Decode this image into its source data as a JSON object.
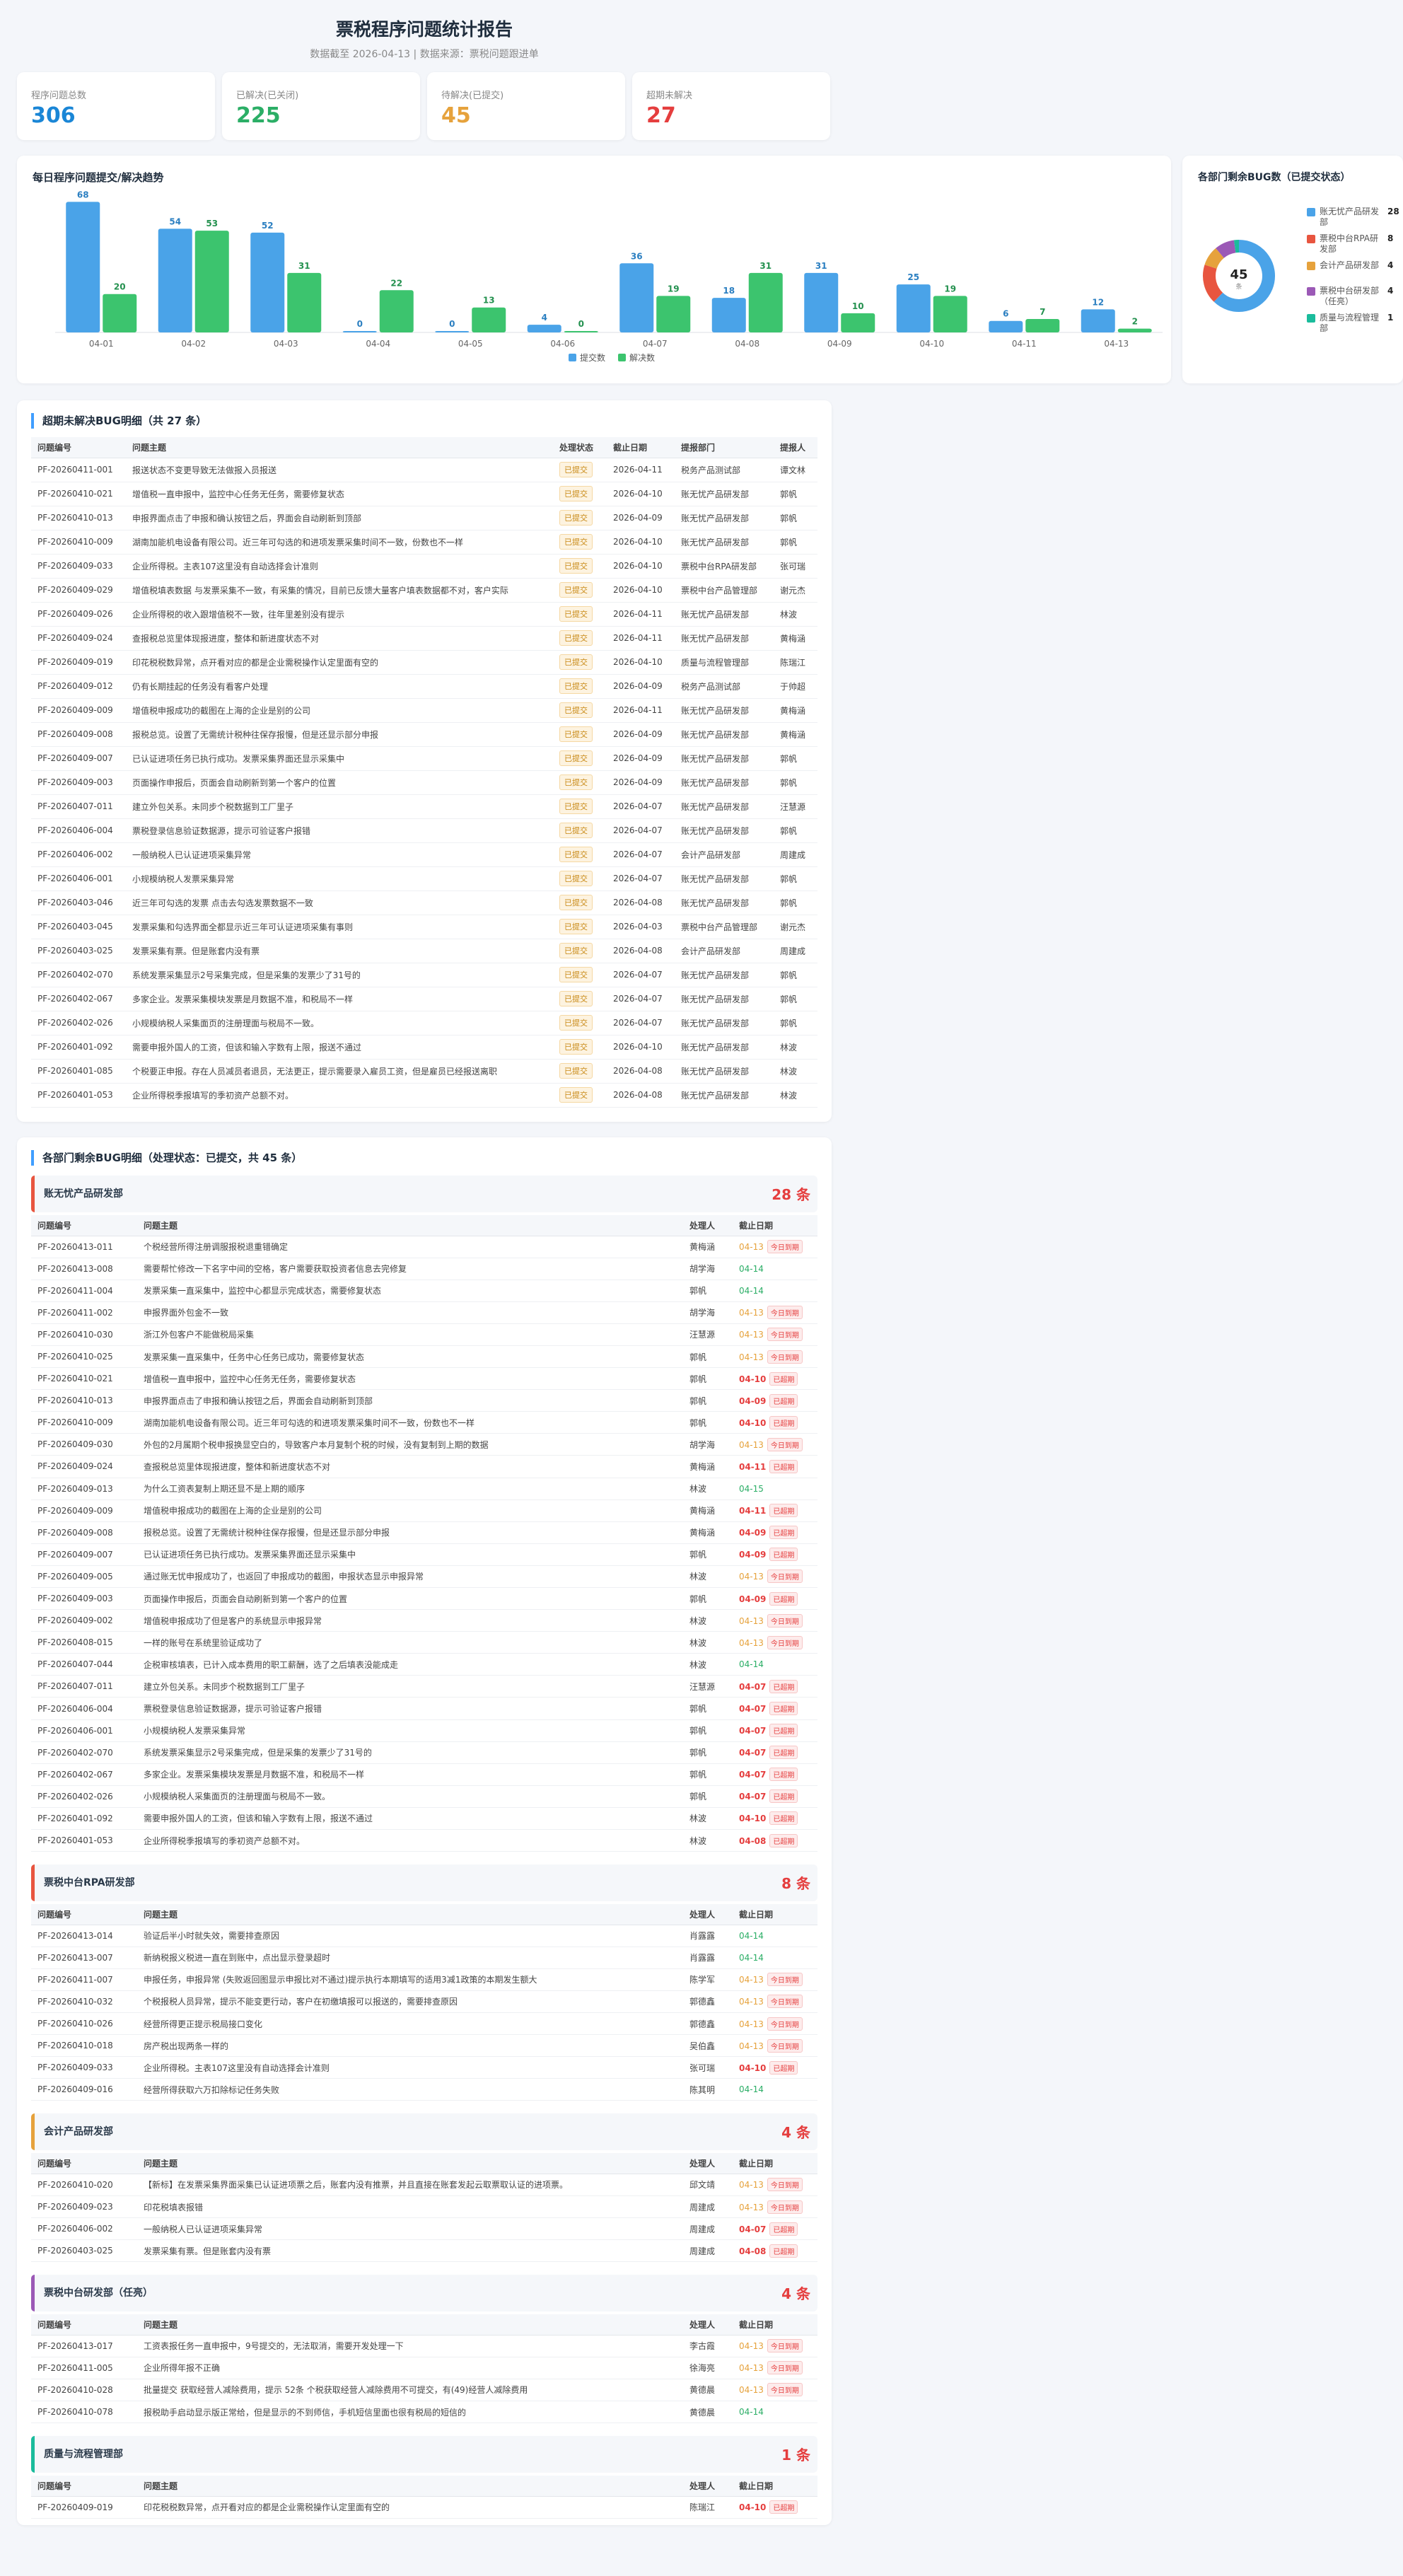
{
  "header": {
    "title": "票税程序问题统计报告",
    "subtitle": "数据截至 2026-04-13 | 数据来源：票税问题跟进单"
  },
  "stats": [
    {
      "label": "程序问题总数",
      "value": "306",
      "color": "#1a86d6"
    },
    {
      "label": "已解决(已关闭)",
      "value": "225",
      "color": "#2bae66"
    },
    {
      "label": "待解决(已提交)",
      "value": "45",
      "color": "#e6a23c"
    },
    {
      "label": "超期未解决",
      "value": "27",
      "color": "#e53e3e"
    }
  ],
  "trend": {
    "title": "每日程序问题提交/解决趋势",
    "legend": [
      "提交数",
      "解决数"
    ],
    "colors": {
      "submit": "#4aa3e8",
      "resolve": "#3cc46e"
    }
  },
  "chart_data": [
    {
      "type": "bar",
      "title": "每日程序问题提交/解决趋势",
      "categories": [
        "04-01",
        "04-02",
        "04-03",
        "04-04",
        "04-05",
        "04-06",
        "04-07",
        "04-08",
        "04-09",
        "04-10",
        "04-11",
        "04-13"
      ],
      "series": [
        {
          "name": "提交数",
          "values": [
            68,
            54,
            52,
            0,
            0,
            4,
            36,
            18,
            31,
            25,
            6,
            12
          ]
        },
        {
          "name": "解决数",
          "values": [
            20,
            53,
            31,
            22,
            13,
            0,
            19,
            31,
            10,
            19,
            7,
            2
          ]
        }
      ],
      "ylim": [
        0,
        70
      ],
      "legend": "bottom"
    },
    {
      "type": "pie",
      "title": "各部门剩余BUG数（已提交状态）",
      "center_total": "45",
      "center_label": "条",
      "labels": [
        "账无忧产品研发部",
        "票税中台RPA研发部",
        "会计产品研发部",
        "票税中台研发部（任亮）",
        "质量与流程管理部"
      ],
      "values": [
        28,
        8,
        4,
        4,
        1
      ],
      "colors": [
        "#4aa3e8",
        "#e8553f",
        "#e6a23c",
        "#9b59b6",
        "#1abc9c"
      ]
    }
  ],
  "donut": {
    "title": "各部门剩余BUG数（已提交状态）"
  },
  "overdue": {
    "title": "超期未解决BUG明细（共 27 条）",
    "columns": [
      "问题编号",
      "问题主题",
      "处理状态",
      "截止日期",
      "提报部门",
      "提报人"
    ],
    "rows": [
      [
        "PF-20260411-001",
        "报送状态不变更导致无法做报入员报送",
        "已提交",
        "2026-04-11",
        "税务产品测试部",
        "谭文林"
      ],
      [
        "PF-20260410-021",
        "增值税一直申报中，监控中心任务无任务，需要修复状态",
        "已提交",
        "2026-04-10",
        "账无忧产品研发部",
        "郭帆"
      ],
      [
        "PF-20260410-013",
        "申报界面点击了申报和确认按钮之后，界面会自动刷新到顶部",
        "已提交",
        "2026-04-09",
        "账无忧产品研发部",
        "郭帆"
      ],
      [
        "PF-20260410-009",
        "湖南加能机电设备有限公司。近三年可勾选的和进项发票采集时间不一致，份数也不一样",
        "已提交",
        "2026-04-10",
        "账无忧产品研发部",
        "郭帆"
      ],
      [
        "PF-20260409-033",
        "企业所得税。主表107这里没有自动选择会计准则",
        "已提交",
        "2026-04-10",
        "票税中台RPA研发部",
        "张可瑞"
      ],
      [
        "PF-20260409-029",
        "增值税填表数据 与发票采集不一致，有采集的情况，目前已反馈大量客户填表数据都不对，客户实际",
        "已提交",
        "2026-04-10",
        "票税中台产品管理部",
        "谢元杰"
      ],
      [
        "PF-20260409-026",
        "企业所得税的收入跟增值税不一致，往年里差别没有提示",
        "已提交",
        "2026-04-11",
        "账无忧产品研发部",
        "林波"
      ],
      [
        "PF-20260409-024",
        "查报税总览里体现报进度，整体和新进度状态不对",
        "已提交",
        "2026-04-11",
        "账无忧产品研发部",
        "黄梅涵"
      ],
      [
        "PF-20260409-019",
        "印花税税数异常，点开看对应的都是企业需税操作认定里面有空的",
        "已提交",
        "2026-04-10",
        "质量与流程管理部",
        "陈瑞江"
      ],
      [
        "PF-20260409-012",
        "仍有长期挂起的任务没有看客户处理",
        "已提交",
        "2026-04-09",
        "税务产品测试部",
        "于帅超"
      ],
      [
        "PF-20260409-009",
        "增值税申报成功的截图在上海的企业是别的公司",
        "已提交",
        "2026-04-11",
        "账无忧产品研发部",
        "黄梅涵"
      ],
      [
        "PF-20260409-008",
        "报税总览。设置了无需统计税种往保存报慢，但是还显示部分申报",
        "已提交",
        "2026-04-09",
        "账无忧产品研发部",
        "黄梅涵"
      ],
      [
        "PF-20260409-007",
        "已认证进项任务已执行成功。发票采集界面还显示采集中",
        "已提交",
        "2026-04-09",
        "账无忧产品研发部",
        "郭帆"
      ],
      [
        "PF-20260409-003",
        "页面操作申报后，页面会自动刷新到第一个客户的位置",
        "已提交",
        "2026-04-09",
        "账无忧产品研发部",
        "郭帆"
      ],
      [
        "PF-20260407-011",
        "建立外包关系。未同步个税数据到工厂里子",
        "已提交",
        "2026-04-07",
        "账无忧产品研发部",
        "汪慧源"
      ],
      [
        "PF-20260406-004",
        "票税登录信息验证数据源，提示可验证客户报错",
        "已提交",
        "2026-04-07",
        "账无忧产品研发部",
        "郭帆"
      ],
      [
        "PF-20260406-002",
        "一般纳税人已认证进项采集异常",
        "已提交",
        "2026-04-07",
        "会计产品研发部",
        "周建成"
      ],
      [
        "PF-20260406-001",
        "小规模纳税人发票采集异常",
        "已提交",
        "2026-04-07",
        "账无忧产品研发部",
        "郭帆"
      ],
      [
        "PF-20260403-046",
        "近三年可勾选的发票 点击去勾选发票数据不一致",
        "已提交",
        "2026-04-08",
        "账无忧产品研发部",
        "郭帆"
      ],
      [
        "PF-20260403-045",
        "发票采集和勾选界面全都显示近三年可认证进项采集有事则",
        "已提交",
        "2026-04-03",
        "票税中台产品管理部",
        "谢元杰"
      ],
      [
        "PF-20260403-025",
        "发票采集有票。但是账套内没有票",
        "已提交",
        "2026-04-08",
        "会计产品研发部",
        "周建成"
      ],
      [
        "PF-20260402-070",
        "系统发票采集显示2号采集完成，但是采集的发票少了31号的",
        "已提交",
        "2026-04-07",
        "账无忧产品研发部",
        "郭帆"
      ],
      [
        "PF-20260402-067",
        "多家企业。发票采集模块发票是月数据不准，和税局不一样",
        "已提交",
        "2026-04-07",
        "账无忧产品研发部",
        "郭帆"
      ],
      [
        "PF-20260402-026",
        "小规模纳税人采集面页的注册理面与税局不一致。",
        "已提交",
        "2026-04-07",
        "账无忧产品研发部",
        "郭帆"
      ],
      [
        "PF-20260401-092",
        "需要申报外国人的工资，但该和输入字数有上限，报送不通过",
        "已提交",
        "2026-04-10",
        "账无忧产品研发部",
        "林波"
      ],
      [
        "PF-20260401-085",
        "个税要正申报。存在人员减员者退员，无法更正，提示需要录入雇员工资，但是雇员已经报送离职",
        "已提交",
        "2026-04-08",
        "账无忧产品研发部",
        "林波"
      ],
      [
        "PF-20260401-053",
        "企业所得税季报填写的季初资产总额不对。",
        "已提交",
        "2026-04-08",
        "账无忧产品研发部",
        "林波"
      ]
    ]
  },
  "dept_detail": {
    "title": "各部门剩余BUG明细（处理状态：已提交，共 45 条）",
    "columns": [
      "问题编号",
      "问题主题",
      "处理人",
      "截止日期"
    ],
    "tags": {
      "today": "今日到期",
      "over": "已超期"
    },
    "groups": [
      {
        "name": "账无忧产品研发部",
        "count": "28 条",
        "color": "#e8553f",
        "rows": [
          [
            "PF-20260413-011",
            "个税经营所得注册调服报税退重错确定",
            "黄梅涵",
            "04-13",
            "today"
          ],
          [
            "PF-20260413-008",
            "需要帮忙修改一下名字中间的空格，客户需要获取投资者信息去完修复",
            "胡学海",
            "04-14",
            "ok"
          ],
          [
            "PF-20260411-004",
            "发票采集一直采集中，监控中心都显示完成状态，需要修复状态",
            "郭帆",
            "04-14",
            "ok"
          ],
          [
            "PF-20260411-002",
            "申报界面外包金不一致",
            "胡学海",
            "04-13",
            "today"
          ],
          [
            "PF-20260410-030",
            "浙江外包客户不能做税局采集",
            "汪慧源",
            "04-13",
            "today"
          ],
          [
            "PF-20260410-025",
            "发票采集一直采集中，任务中心任务已成功，需要修复状态",
            "郭帆",
            "04-13",
            "today"
          ],
          [
            "PF-20260410-021",
            "增值税一直申报中，监控中心任务无任务，需要修复状态",
            "郭帆",
            "04-10",
            "over"
          ],
          [
            "PF-20260410-013",
            "申报界面点击了申报和确认按钮之后，界面会自动刷新到顶部",
            "郭帆",
            "04-09",
            "over"
          ],
          [
            "PF-20260410-009",
            "湖南加能机电设备有限公司。近三年可勾选的和进项发票采集时间不一致，份数也不一样",
            "郭帆",
            "04-10",
            "over"
          ],
          [
            "PF-20260409-030",
            "外包的2月属期个税申报换显空白的，导致客户本月复制个税的时候，没有复制到上期的数据",
            "胡学海",
            "04-13",
            "today"
          ],
          [
            "PF-20260409-024",
            "查报税总览里体现报进度，整体和新进度状态不对",
            "黄梅涵",
            "04-11",
            "over"
          ],
          [
            "PF-20260409-013",
            "为什么工资表复制上期还显不是上期的顺序",
            "林波",
            "04-15",
            "ok"
          ],
          [
            "PF-20260409-009",
            "增值税申报成功的截图在上海的企业是别的公司",
            "黄梅涵",
            "04-11",
            "over"
          ],
          [
            "PF-20260409-008",
            "报税总览。设置了无需统计税种往保存报慢，但是还显示部分申报",
            "黄梅涵",
            "04-09",
            "over"
          ],
          [
            "PF-20260409-007",
            "已认证进项任务已执行成功。发票采集界面还显示采集中",
            "郭帆",
            "04-09",
            "over"
          ],
          [
            "PF-20260409-005",
            "通过账无忧申报成功了，也返回了申报成功的截图，申报状态显示申报异常",
            "林波",
            "04-13",
            "today"
          ],
          [
            "PF-20260409-003",
            "页面操作申报后，页面会自动刷新到第一个客户的位置",
            "郭帆",
            "04-09",
            "over"
          ],
          [
            "PF-20260409-002",
            "增值税申报成功了但是客户的系统显示申报异常",
            "林波",
            "04-13",
            "today"
          ],
          [
            "PF-20260408-015",
            "一样的账号在系统里验证成功了",
            "林波",
            "04-13",
            "today"
          ],
          [
            "PF-20260407-044",
            "企税审核填表，已计入成本费用的职工薪酬，选了之后填表没能成走",
            "林波",
            "04-14",
            "ok"
          ],
          [
            "PF-20260407-011",
            "建立外包关系。未同步个税数据到工厂里子",
            "汪慧源",
            "04-07",
            "over"
          ],
          [
            "PF-20260406-004",
            "票税登录信息验证数据源，提示可验证客户报错",
            "郭帆",
            "04-07",
            "over"
          ],
          [
            "PF-20260406-001",
            "小规模纳税人发票采集异常",
            "郭帆",
            "04-07",
            "over"
          ],
          [
            "PF-20260402-070",
            "系统发票采集显示2号采集完成，但是采集的发票少了31号的",
            "郭帆",
            "04-07",
            "over"
          ],
          [
            "PF-20260402-067",
            "多家企业。发票采集模块发票是月数据不准，和税局不一样",
            "郭帆",
            "04-07",
            "over"
          ],
          [
            "PF-20260402-026",
            "小规模纳税人采集面页的注册理面与税局不一致。",
            "郭帆",
            "04-07",
            "over"
          ],
          [
            "PF-20260401-092",
            "需要申报外国人的工资，但该和输入字数有上限，报送不通过",
            "林波",
            "04-10",
            "over"
          ],
          [
            "PF-20260401-053",
            "企业所得税季报填写的季初资产总额不对。",
            "林波",
            "04-08",
            "over"
          ]
        ]
      },
      {
        "name": "票税中台RPA研发部",
        "count": "8 条",
        "color": "#e8553f",
        "rows": [
          [
            "PF-20260413-014",
            "验证后半小时就失效，需要排查原因",
            "肖露露",
            "04-14",
            "ok"
          ],
          [
            "PF-20260413-007",
            "新纳税报义税进一直在到账中，点出显示登录超时",
            "肖露露",
            "04-14",
            "ok"
          ],
          [
            "PF-20260411-007",
            "申报任务，申报异常 (失败返回图显示申报比对不通过)提示执行本期填写的适用3减1政策的本期发生额大",
            "陈学军",
            "04-13",
            "today"
          ],
          [
            "PF-20260410-032",
            "个税报税人员异常，提示不能变更行动，客户在初缴填报可以报送的，需要排查原因",
            "郭德鑫",
            "04-13",
            "today"
          ],
          [
            "PF-20260410-026",
            "经营所得更正提示税局接口变化",
            "郭德鑫",
            "04-13",
            "today"
          ],
          [
            "PF-20260410-018",
            "房产税出现两条一样的",
            "吴伯鑫",
            "04-13",
            "today"
          ],
          [
            "PF-20260409-033",
            "企业所得税。主表107这里没有自动选择会计准则",
            "张可瑞",
            "04-10",
            "over"
          ],
          [
            "PF-20260409-016",
            "经营所得获取六万扣除标记任务失败",
            "陈其明",
            "04-14",
            "ok"
          ]
        ]
      },
      {
        "name": "会计产品研发部",
        "count": "4 条",
        "color": "#e6a23c",
        "rows": [
          [
            "PF-20260410-020",
            "【新标】在发票采集界面采集已认证进项票之后，账套内没有推票，并且直接在账套发起云取票取认证的进项票。",
            "邱文靖",
            "04-13",
            "today"
          ],
          [
            "PF-20260409-023",
            "印花税填表报错",
            "周建成",
            "04-13",
            "today"
          ],
          [
            "PF-20260406-002",
            "一般纳税人已认证进项采集异常",
            "周建成",
            "04-07",
            "over"
          ],
          [
            "PF-20260403-025",
            "发票采集有票。但是账套内没有票",
            "周建成",
            "04-08",
            "over"
          ]
        ]
      },
      {
        "name": "票税中台研发部（任亮）",
        "count": "4 条",
        "color": "#9b59b6",
        "rows": [
          [
            "PF-20260413-017",
            "工资表报任务一直申报中，9号提交的，无法取消，需要开发处理一下",
            "李古霞",
            "04-13",
            "today"
          ],
          [
            "PF-20260411-005",
            "企业所得年报不正确",
            "徐海亮",
            "04-13",
            "today"
          ],
          [
            "PF-20260410-028",
            "批量提交 获取经营人减除费用，提示 52条 个税获取经营人减除费用不可提交，有(49)经营人减除费用",
            "黄德晨",
            "04-13",
            "today"
          ],
          [
            "PF-20260410-078",
            "报税助手启动显示版正常给，但是显示的不到师信，手机短信里面也很有税局的短信的",
            "黄德晨",
            "04-14",
            "ok"
          ]
        ]
      },
      {
        "name": "质量与流程管理部",
        "count": "1 条",
        "color": "#1abc9c",
        "rows": [
          [
            "PF-20260409-019",
            "印花税税数异常，点开看对应的都是企业需税操作认定里面有空的",
            "陈瑞江",
            "04-10",
            "over"
          ]
        ]
      }
    ]
  }
}
